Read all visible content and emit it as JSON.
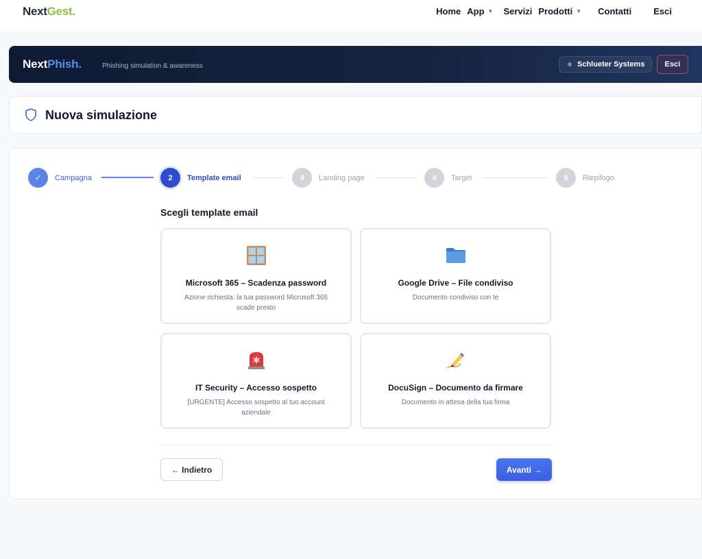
{
  "topnav": {
    "brand_main": "Next",
    "brand_accent": "Gest.",
    "links": [
      {
        "label": "Home"
      },
      {
        "label": "App"
      },
      {
        "label": "Servizi"
      },
      {
        "label": "Prodotti"
      },
      {
        "label": "Contatti"
      },
      {
        "label": "Esci"
      }
    ]
  },
  "hero": {
    "brand_main": "Next",
    "brand_accent": "Phish.",
    "subtitle": "Phishing simulation & awareness",
    "organization": "Schlueter Systems",
    "exit_label": "Esci"
  },
  "page": {
    "title": "Nuova simulazione",
    "title_icon": "shield-icon"
  },
  "stepper": {
    "steps": [
      {
        "number": "✓",
        "label": "Campagna",
        "state": "done"
      },
      {
        "number": "2",
        "label": "Template email",
        "state": "active"
      },
      {
        "number": "3",
        "label": "Landing page",
        "state": "todo"
      },
      {
        "number": "4",
        "label": "Target",
        "state": "todo"
      },
      {
        "number": "5",
        "label": "Riepilogo",
        "state": "todo"
      }
    ]
  },
  "templates": {
    "heading": "Scegli template email",
    "items": [
      {
        "name": "Microsoft 365 – Scadenza password",
        "description": "Azione richiesta: la tua password Microsoft 365 scade presto",
        "icon": "window-icon"
      },
      {
        "name": "Google Drive – File condiviso",
        "description": "Documento condiviso con te",
        "icon": "folder-icon"
      },
      {
        "name": "IT Security – Accesso sospetto",
        "description": "[URGENTE] Accesso sospetto al tuo account aziendale",
        "icon": "siren-icon"
      },
      {
        "name": "DocuSign – Documento da firmare",
        "description": "Documento in attesa della tua firma",
        "icon": "signature-icon"
      }
    ]
  },
  "actions": {
    "back_label": "← Indietro",
    "next_label": "Avanti →"
  },
  "colors": {
    "brand_green": "#8fbf3f",
    "accent_blue": "#3a5fe0",
    "hero_bg": "#0f1b33"
  }
}
